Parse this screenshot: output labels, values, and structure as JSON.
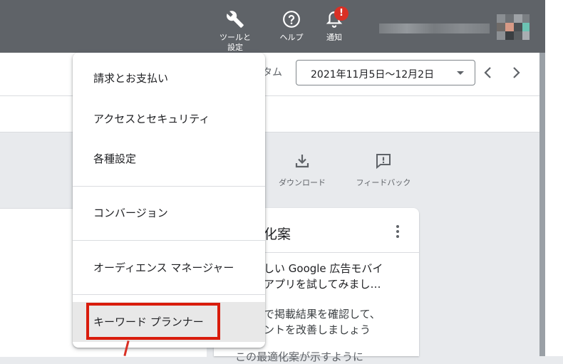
{
  "header": {
    "tools_label_line1": "ツールと",
    "tools_label_line2": "設定",
    "help_label": "ヘルプ",
    "notifications_label": "通知",
    "notification_badge": "!"
  },
  "date_range": {
    "label_partial": "タム",
    "value": "2021年11月5日〜12月2日",
    "prev_icon": "chevron-left-icon",
    "next_icon": "chevron-right-icon"
  },
  "actions": [
    {
      "label": "ダウンロード",
      "icon": "download-icon"
    },
    {
      "label": "フィードバック",
      "icon": "feedback-icon"
    }
  ],
  "card": {
    "title": "化案",
    "line1": "しい Google 広告モバイ",
    "line2": "アプリを試してみまし…",
    "line3": "で掲載結果を確認して、",
    "line4": "ントを改善しましょう",
    "line5": "この最適化案が示すように"
  },
  "menu": {
    "items": [
      {
        "label": "請求とお支払い"
      },
      {
        "label": "アクセスとセキュリティ"
      },
      {
        "label": "各種設定"
      },
      {
        "label": "コンバージョン"
      },
      {
        "label": "オーディエンス マネージャー"
      },
      {
        "label": "キーワード プランナー"
      }
    ]
  },
  "colors": {
    "topbar": "#5f6368",
    "highlight_box": "#d91c0c",
    "badge": "#d93025"
  }
}
